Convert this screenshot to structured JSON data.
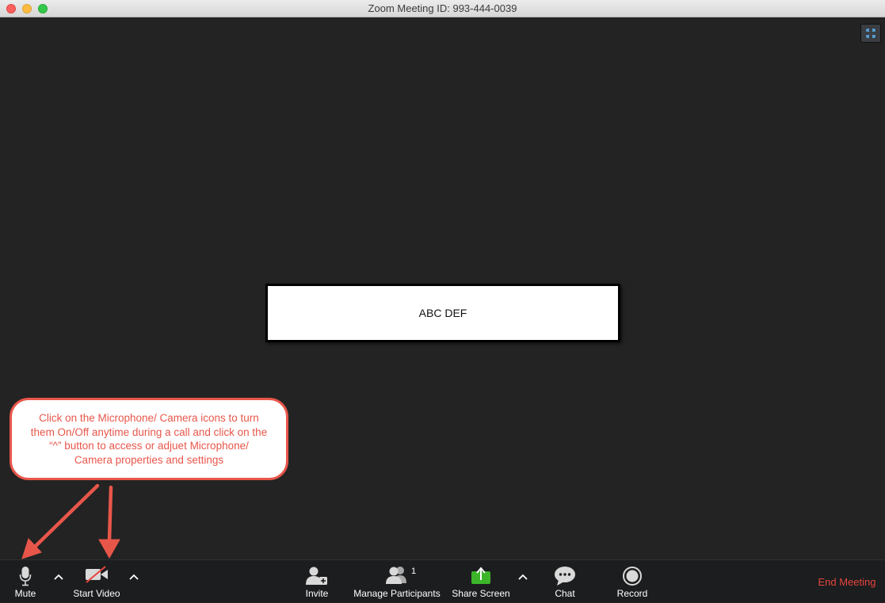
{
  "window": {
    "title": "Zoom Meeting ID: 993-444-0039"
  },
  "participant": {
    "name": "ABC DEF"
  },
  "annotation": {
    "text": "Click on the Microphone/ Camera icons to turn them On/Off anytime during a call and click on the “^” button to access or adjuet Microphone/ Camera properties and settings"
  },
  "toolbar": {
    "mute_label": "Mute",
    "start_video_label": "Start Video",
    "invite_label": "Invite",
    "manage_participants_label": "Manage Participants",
    "participant_count": "1",
    "share_screen_label": "Share Screen",
    "chat_label": "Chat",
    "record_label": "Record",
    "end_meeting_label": "End Meeting"
  },
  "colors": {
    "end_meeting": "#e8453c",
    "annotation": "#e8564a",
    "share_screen": "#3cb52a"
  }
}
